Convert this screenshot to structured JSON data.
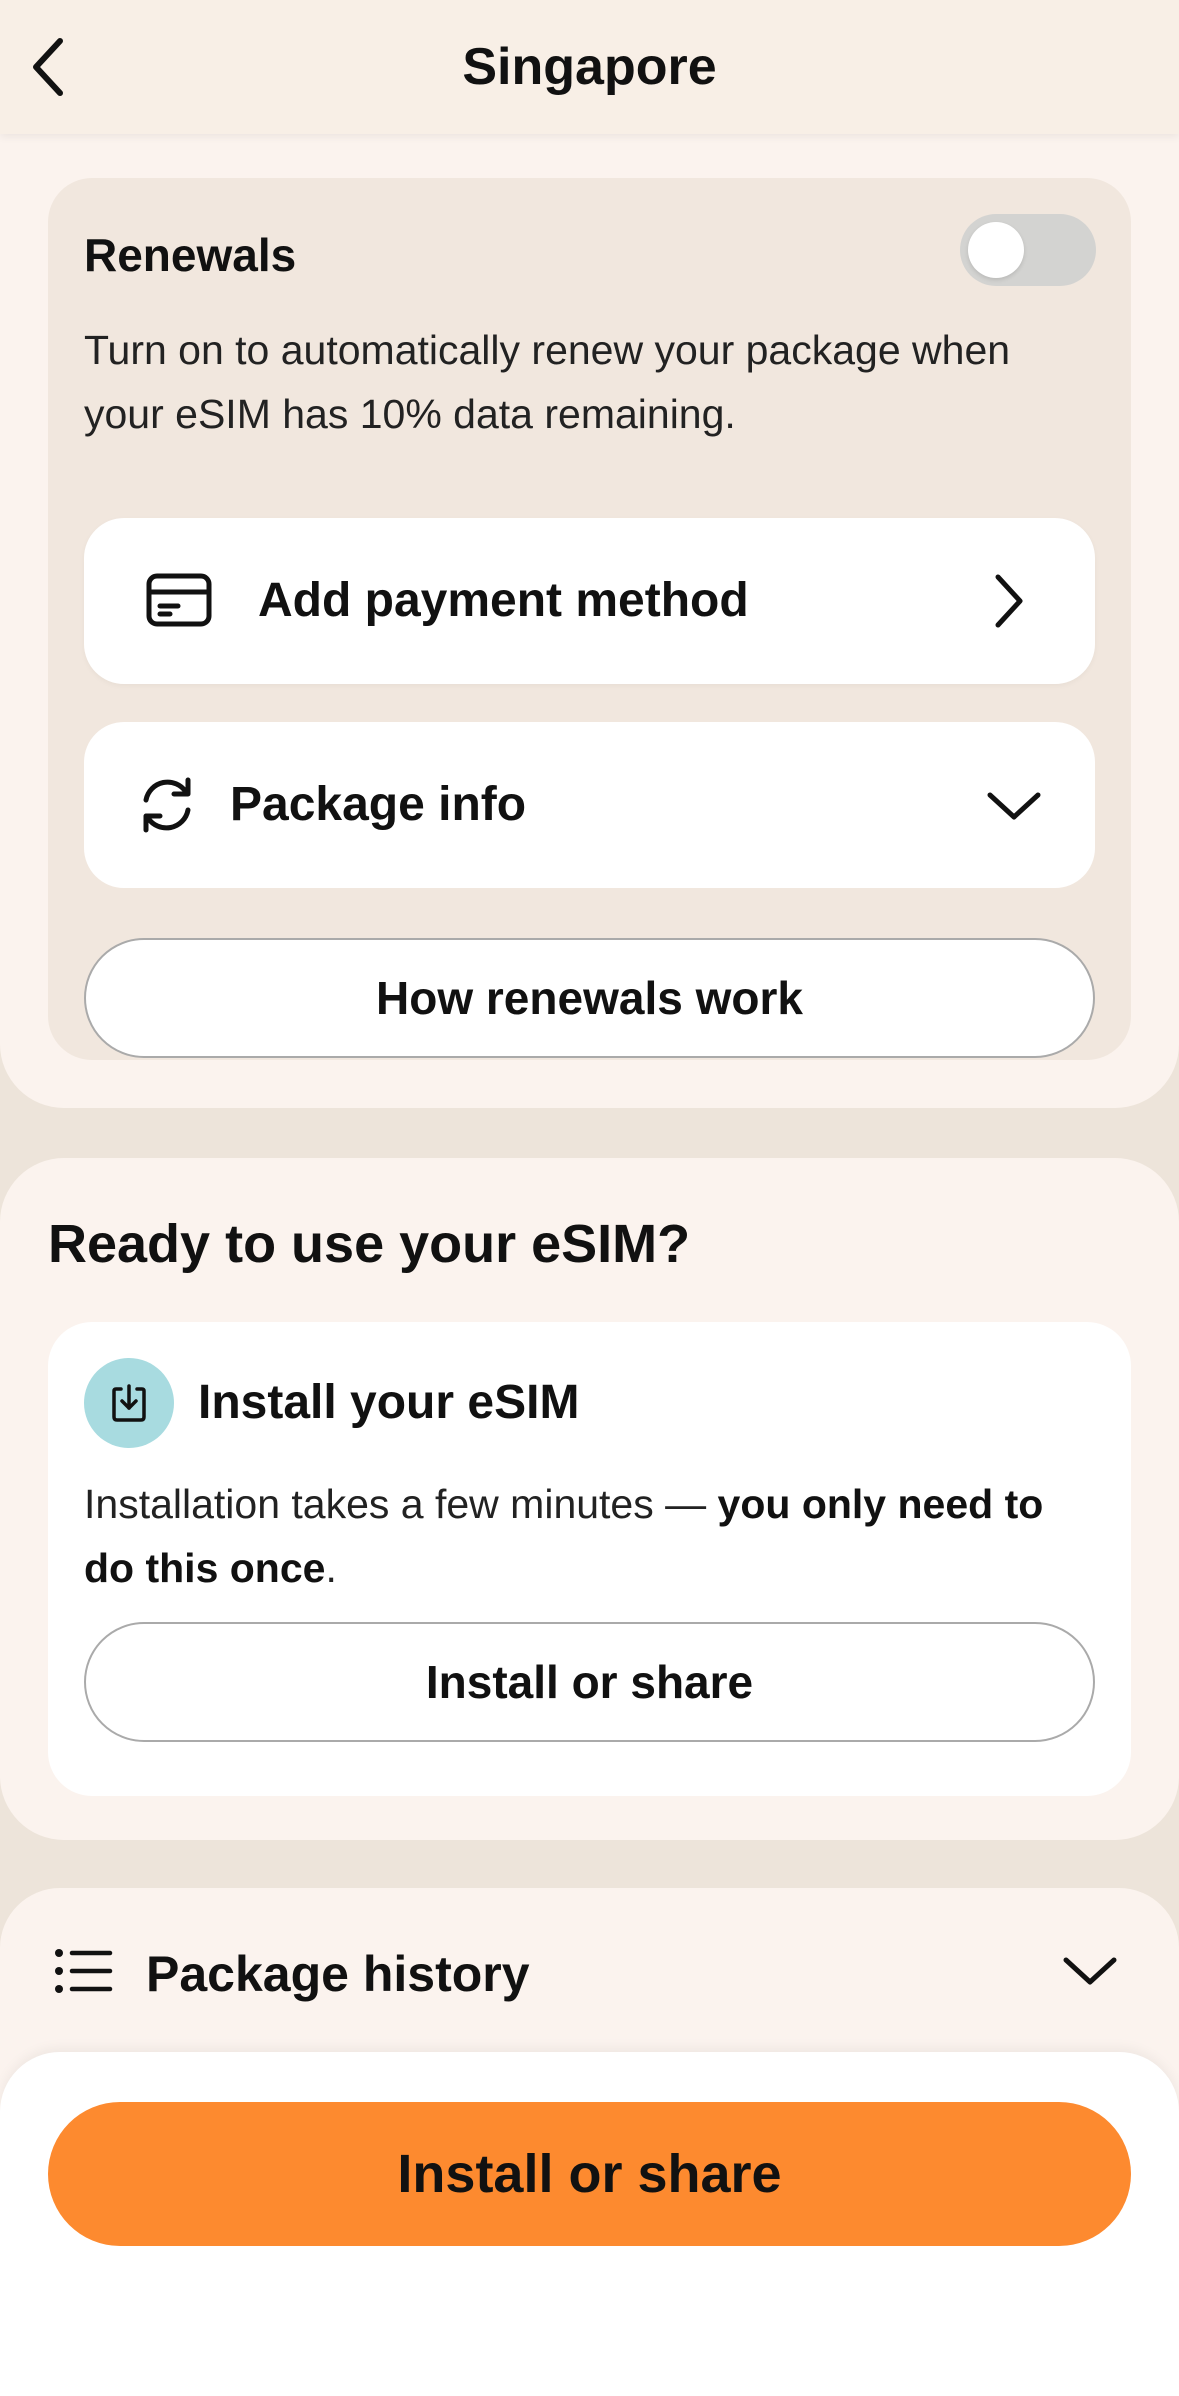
{
  "header": {
    "title": "Singapore",
    "back_icon": "chevron-left-icon"
  },
  "renewals": {
    "title": "Renewals",
    "toggle_on": false,
    "description": "Turn on to automatically renew your package when your eSIM has 10% data remaining.",
    "payment_row": {
      "label": "Add payment method",
      "icon": "credit-card-icon",
      "chevron": "chevron-right-icon"
    },
    "package_row": {
      "label": "Package info",
      "icon": "refresh-icon",
      "chevron": "chevron-down-icon"
    },
    "how_button": "How renewals work"
  },
  "ready": {
    "title": "Ready to use your eSIM?",
    "install_card": {
      "title": "Install your eSIM",
      "icon": "download-icon",
      "desc_regular": "Installation takes a few minutes — ",
      "desc_bold": "you only need to do this once",
      "desc_end": ".",
      "button": "Install or share"
    }
  },
  "history": {
    "label": "Package history",
    "icon": "list-icon",
    "chevron": "chevron-down-icon"
  },
  "bottom": {
    "primary_button": "Install or share"
  },
  "colors": {
    "accent": "#fd8a2f",
    "page_bg": "#ede4da",
    "card_bg": "#f1e7de",
    "icon_bg": "#a8dbe0"
  }
}
